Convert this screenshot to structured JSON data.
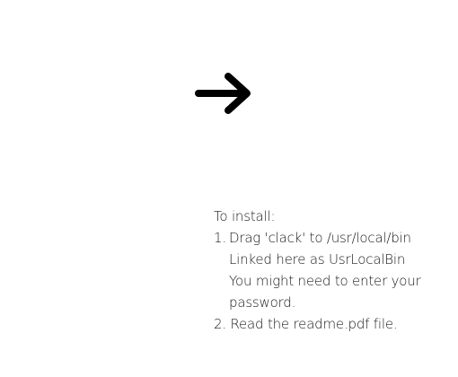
{
  "arrow_icon": "right-arrow-icon",
  "instructions": {
    "heading": "To install:",
    "step1_number": "1.",
    "step1_text": "Drag 'clack' to /usr/local/bin",
    "step1_line2": "Linked here as UsrLocalBin",
    "step1_line3": "You might need to enter your",
    "step1_line4": "password.",
    "step2_text": "2. Read the readme.pdf file."
  }
}
